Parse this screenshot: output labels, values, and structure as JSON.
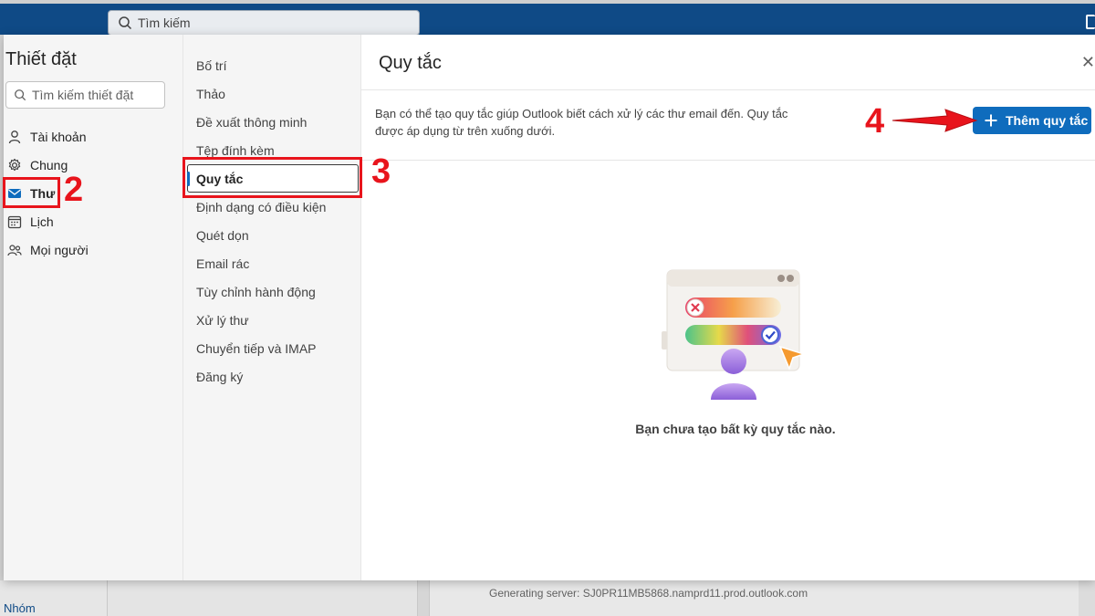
{
  "topbar": {
    "search_placeholder": "Tìm kiếm"
  },
  "settings": {
    "title": "Thiết đặt",
    "search_placeholder": "Tìm kiếm thiết đặt",
    "nav": [
      {
        "label": "Tài khoản",
        "icon": "person-icon"
      },
      {
        "label": "Chung",
        "icon": "gear-icon"
      },
      {
        "label": "Thư",
        "icon": "mail-icon",
        "active": true
      },
      {
        "label": "Lịch",
        "icon": "calendar-icon"
      },
      {
        "label": "Mọi người",
        "icon": "people-icon"
      }
    ],
    "subnav": [
      {
        "label": "Bố trí"
      },
      {
        "label": "Thảo"
      },
      {
        "label": "Đề xuất thông minh"
      },
      {
        "label": "Tệp đính kèm"
      },
      {
        "label": "Quy tắc",
        "active": true
      },
      {
        "label": "Định dạng có điều kiện"
      },
      {
        "label": "Quét dọn"
      },
      {
        "label": "Email rác"
      },
      {
        "label": "Tùy chỉnh hành động"
      },
      {
        "label": "Xử lý thư"
      },
      {
        "label": "Chuyển tiếp và IMAP"
      },
      {
        "label": "Đăng ký"
      }
    ]
  },
  "pane": {
    "title": "Quy tắc",
    "description": "Bạn có thể tạo quy tắc giúp Outlook biết cách xử lý các thư email đến. Quy tắc được áp dụng từ trên xuống dưới.",
    "add_button_label": "Thêm quy tắc",
    "empty_text": "Bạn chưa tạo bất kỳ quy tắc nào."
  },
  "background": {
    "left_label": "Nhóm",
    "server_text": "Generating server: SJ0PR11MB5868.namprd11.prod.outlook.com"
  },
  "annotations": {
    "step2": "2",
    "step3": "3",
    "step4": "4"
  },
  "colors": {
    "brand": "#0f4a86",
    "accent": "#0f6cbd",
    "annotation": "#e8141c"
  }
}
